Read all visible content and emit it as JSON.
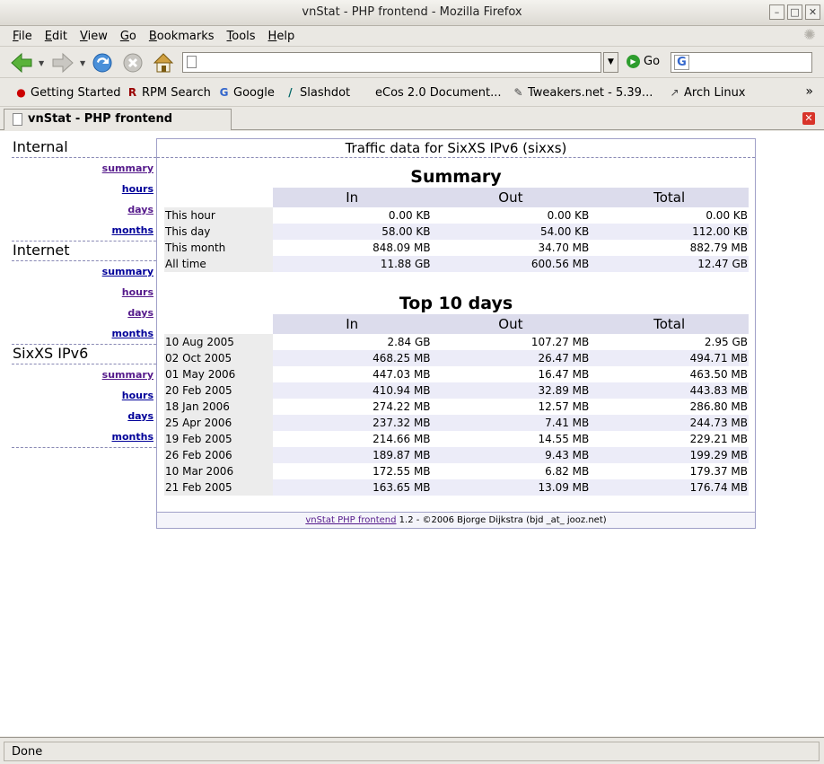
{
  "window": {
    "title": "vnStat - PHP frontend - Mozilla Firefox"
  },
  "menubar": [
    "File",
    "Edit",
    "View",
    "Go",
    "Bookmarks",
    "Tools",
    "Help"
  ],
  "toolbar": {
    "url": "",
    "go_label": "Go",
    "search_value": ""
  },
  "bookmarks": [
    {
      "label": "Getting Started",
      "icon": "redhat-icon"
    },
    {
      "label": "RPM Search",
      "icon": "rpm-icon"
    },
    {
      "label": "Google",
      "icon": "google-icon"
    },
    {
      "label": "Slashdot",
      "icon": "slashdot-icon"
    },
    {
      "label": "eCos 2.0 Document...",
      "icon": ""
    },
    {
      "label": "Tweakers.net - 5.39...",
      "icon": "tweakers-icon"
    },
    {
      "label": "Arch Linux",
      "icon": "arch-icon"
    }
  ],
  "tab": {
    "label": "vnStat - PHP frontend"
  },
  "sidebar": [
    {
      "title": "Internal",
      "links": [
        "summary",
        "hours",
        "days",
        "months"
      ]
    },
    {
      "title": "Internet",
      "links": [
        "summary",
        "hours",
        "days",
        "months"
      ]
    },
    {
      "title": "SixXS IPv6",
      "links": [
        "summary",
        "hours",
        "days",
        "months"
      ]
    }
  ],
  "main": {
    "title": "Traffic data for SixXS IPv6 (sixxs)",
    "summary": {
      "heading": "Summary",
      "columns": [
        "In",
        "Out",
        "Total"
      ],
      "rows": [
        {
          "label": "This hour",
          "in": "0.00 KB",
          "out": "0.00 KB",
          "total": "0.00 KB"
        },
        {
          "label": "This day",
          "in": "58.00 KB",
          "out": "54.00 KB",
          "total": "112.00 KB"
        },
        {
          "label": "This month",
          "in": "848.09 MB",
          "out": "34.70 MB",
          "total": "882.79 MB"
        },
        {
          "label": "All time",
          "in": "11.88 GB",
          "out": "600.56 MB",
          "total": "12.47 GB"
        }
      ]
    },
    "top10": {
      "heading": "Top 10 days",
      "columns": [
        "In",
        "Out",
        "Total"
      ],
      "rows": [
        {
          "label": "10 Aug 2005",
          "in": "2.84 GB",
          "out": "107.27 MB",
          "total": "2.95 GB"
        },
        {
          "label": "02 Oct 2005",
          "in": "468.25 MB",
          "out": "26.47 MB",
          "total": "494.71 MB"
        },
        {
          "label": "01 May 2006",
          "in": "447.03 MB",
          "out": "16.47 MB",
          "total": "463.50 MB"
        },
        {
          "label": "20 Feb 2005",
          "in": "410.94 MB",
          "out": "32.89 MB",
          "total": "443.83 MB"
        },
        {
          "label": "18 Jan 2006",
          "in": "274.22 MB",
          "out": "12.57 MB",
          "total": "286.80 MB"
        },
        {
          "label": "25 Apr 2006",
          "in": "237.32 MB",
          "out": "7.41 MB",
          "total": "244.73 MB"
        },
        {
          "label": "19 Feb 2005",
          "in": "214.66 MB",
          "out": "14.55 MB",
          "total": "229.21 MB"
        },
        {
          "label": "26 Feb 2006",
          "in": "189.87 MB",
          "out": "9.43 MB",
          "total": "199.29 MB"
        },
        {
          "label": "10 Mar 2006",
          "in": "172.55 MB",
          "out": "6.82 MB",
          "total": "179.37 MB"
        },
        {
          "label": "21 Feb 2005",
          "in": "163.65 MB",
          "out": "13.09 MB",
          "total": "176.74 MB"
        }
      ]
    },
    "footer": {
      "link": "vnStat PHP frontend",
      "text": " 1.2 - ©2006 Bjorge Dijkstra (bjd _at_ jooz.net)"
    }
  },
  "status": {
    "text": "Done"
  },
  "colors": {
    "accent": "#000099",
    "visited": "#551a8b",
    "header_bg": "#dcdcec"
  }
}
